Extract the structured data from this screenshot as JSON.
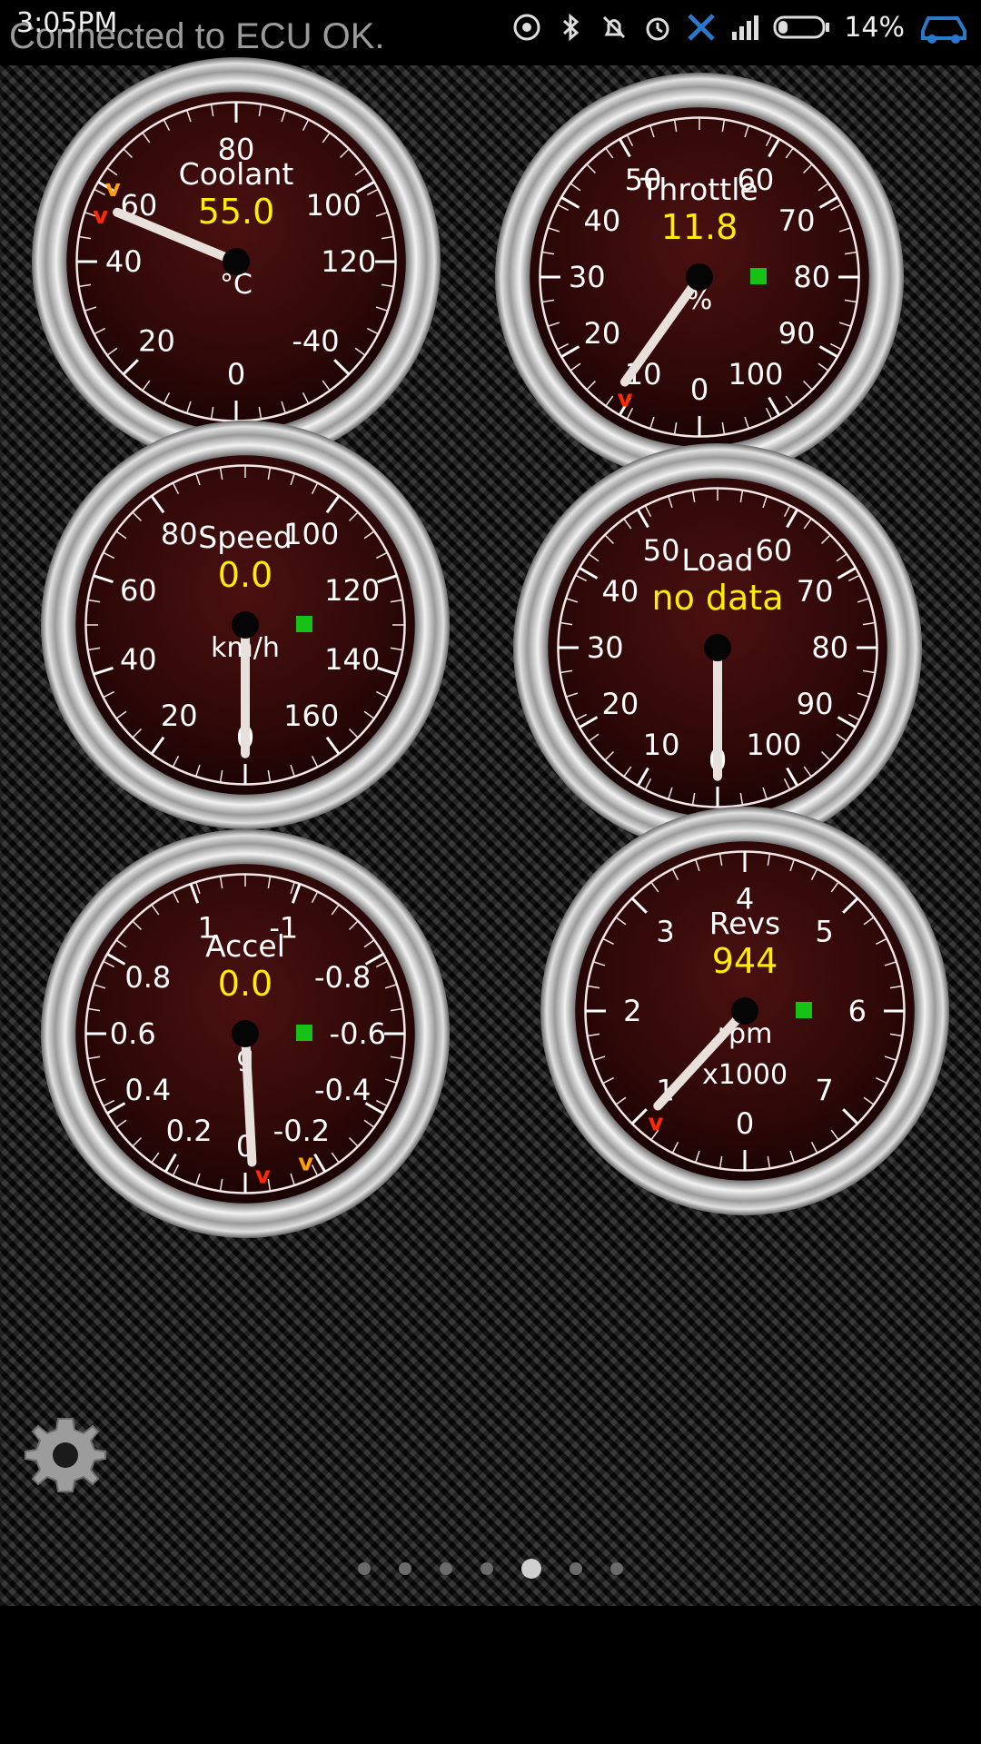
{
  "status_bar": {
    "time": "3:05PM",
    "message": "Connected to ECU OK.",
    "battery": "14%",
    "icons": [
      "hotspot-icon",
      "bluetooth-icon",
      "mute-bell-icon",
      "alarm-icon",
      "tools-icon",
      "signal-icon",
      "battery-icon",
      "car-icon"
    ]
  },
  "colors": {
    "face": "#3a0a0a",
    "value": "#ffee00",
    "needle": "#e8e0da",
    "text": "#ffffff",
    "green_indicator": "#17c217",
    "max_marker": "#ff2a00",
    "min_marker": "#ffa000"
  },
  "gauges": [
    {
      "id": "coolant",
      "title": "Coolant",
      "value": "55.0",
      "unit": "°C",
      "ticks": [
        "0",
        "20",
        "40",
        "60",
        "80",
        "100",
        "120",
        "-40"
      ],
      "reading": 55.0,
      "has_indicator": false,
      "markers": [
        "max",
        "min"
      ]
    },
    {
      "id": "throttle",
      "title": "Throttle",
      "value": "11.8",
      "unit": "%",
      "ticks": [
        "0",
        "10",
        "20",
        "30",
        "40",
        "50",
        "60",
        "70",
        "80",
        "90",
        "100"
      ],
      "reading": 11.8,
      "has_indicator": true,
      "markers": [
        "max"
      ]
    },
    {
      "id": "speed",
      "title": "Speed",
      "value": "0.0",
      "unit": "km/h",
      "ticks": [
        "0",
        "20",
        "40",
        "60",
        "80",
        "100",
        "120",
        "140",
        "160"
      ],
      "reading": 0.0,
      "has_indicator": true,
      "markers": []
    },
    {
      "id": "load",
      "title": "Load",
      "value": "no data",
      "unit": "",
      "ticks": [
        "0",
        "10",
        "20",
        "30",
        "40",
        "50",
        "60",
        "70",
        "80",
        "90",
        "100"
      ],
      "reading": 0,
      "has_indicator": false,
      "markers": []
    },
    {
      "id": "accel",
      "title": "Accel",
      "value": "0.0",
      "unit": "g",
      "ticks": [
        "0",
        "-0.2",
        "-0.4",
        "-0.6",
        "-0.8",
        "-1",
        "1",
        "0.8",
        "0.6",
        "0.4",
        "0.2"
      ],
      "reading": -0.02,
      "has_indicator": true,
      "markers": [
        "max",
        "min"
      ]
    },
    {
      "id": "revs",
      "title": "Revs",
      "value": "944",
      "unit": "rpm",
      "unit2": "x1000",
      "ticks": [
        "0",
        "1",
        "2",
        "3",
        "4",
        "5",
        "6",
        "7"
      ],
      "reading": 0.944,
      "has_indicator": true,
      "markers": [
        "max"
      ]
    }
  ],
  "pager": {
    "pages": 7,
    "active": 4
  }
}
